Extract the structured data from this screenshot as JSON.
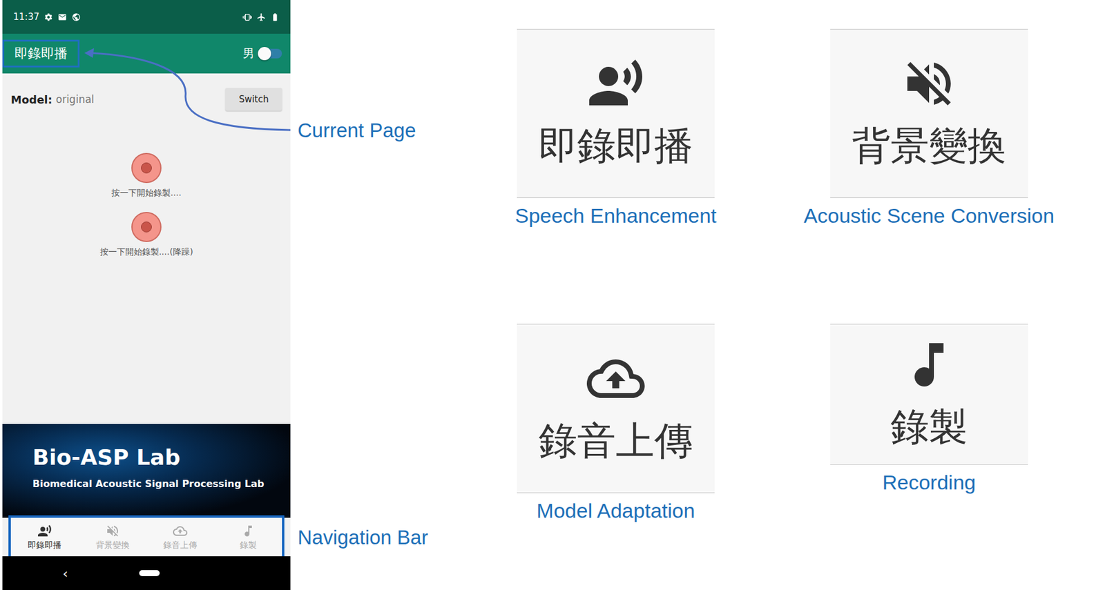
{
  "status_bar": {
    "time": "11:37"
  },
  "app_bar": {
    "title": "即錄即播",
    "gender_label": "男",
    "gender_switch_on": false
  },
  "model": {
    "label": "Model:",
    "value": "original",
    "button": "Switch"
  },
  "record_buttons": [
    {
      "label": "按一下開始錄製...."
    },
    {
      "label": "按一下開始錄製....(降躁)"
    }
  ],
  "banner": {
    "title": "Bio-ASP Lab",
    "subtitle": "Biomedical Acoustic Signal Processing Lab"
  },
  "nav_items": [
    {
      "label": "即錄即播",
      "selected": true
    },
    {
      "label": "背景變換",
      "selected": false
    },
    {
      "label": "錄音上傳",
      "selected": false
    },
    {
      "label": "錄製",
      "selected": false
    }
  ],
  "system_nav": {
    "back": "‹"
  },
  "annotations": {
    "current_page": "Current Page",
    "navigation_bar": "Navigation Bar"
  },
  "tiles": [
    {
      "label": "即錄即播",
      "caption": "Speech Enhancement"
    },
    {
      "label": "背景變換",
      "caption": "Acoustic Scene Conversion"
    },
    {
      "label": "錄音上傳",
      "caption": "Model Adaptation"
    },
    {
      "label": "錄製",
      "caption": "Recording"
    }
  ]
}
